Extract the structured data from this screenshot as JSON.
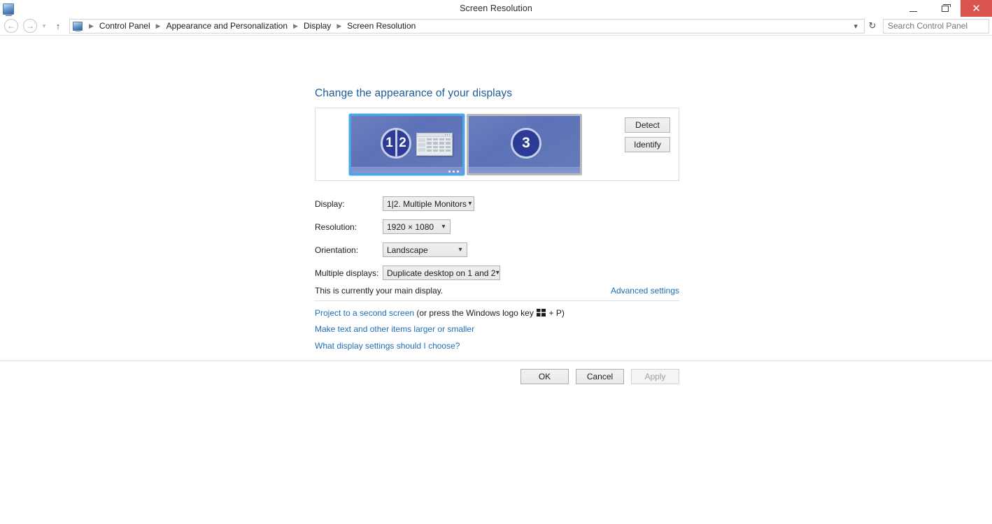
{
  "window": {
    "title": "Screen Resolution",
    "icon": "display-icon",
    "controls": {
      "minimize": "minimize-icon",
      "maximize": "restore-icon",
      "close": "close-icon"
    }
  },
  "addressbar": {
    "back": "back-arrow-icon",
    "forward": "forward-arrow-icon",
    "recent": "chevron-down-icon",
    "up": "up-arrow-icon",
    "breadcrumb": [
      "Control Panel",
      "Appearance and Personalization",
      "Display",
      "Screen Resolution"
    ],
    "history_dropdown": "chevron-down-icon",
    "refresh": "refresh-icon",
    "search": {
      "placeholder": "Search Control Panel",
      "value": "",
      "icon": "search-icon"
    }
  },
  "main": {
    "page_title": "Change the appearance of your displays",
    "preview": {
      "monitors": [
        {
          "id": "monitor-1-2",
          "label_left": "1",
          "label_right": "2",
          "selected": true,
          "dual": true
        },
        {
          "id": "monitor-3",
          "label": "3",
          "selected": false,
          "dual": false
        }
      ],
      "buttons": {
        "detect": "Detect",
        "identify": "Identify"
      }
    },
    "fields": [
      {
        "name": "display",
        "label": "Display:",
        "value": "1|2. Multiple Monitors"
      },
      {
        "name": "resolution",
        "label": "Resolution:",
        "value": "1920 × 1080"
      },
      {
        "name": "orientation",
        "label": "Orientation:",
        "value": "Landscape"
      },
      {
        "name": "multiple-displays",
        "label": "Multiple displays:",
        "value": "Duplicate desktop on 1 and 2"
      }
    ],
    "status_text": "This is currently your main display.",
    "advanced_settings_link": "Advanced settings",
    "links": {
      "project_prefix": "Project to a second screen",
      "project_mid": " (or press the Windows logo key ",
      "project_suffix": " + P)",
      "make_text": "Make text and other items larger or smaller",
      "what_display": "What display settings should I choose?"
    }
  },
  "footer": {
    "ok": "OK",
    "cancel": "Cancel",
    "apply": "Apply",
    "apply_disabled": true
  },
  "colors": {
    "accent_link": "#1f6eb5",
    "title_blue": "#1f5c99",
    "close_red": "#d9534f",
    "monitor_screen": "#657ab9",
    "monitor_badge": "#2b3b96",
    "selection_blue": "#4aa6e8"
  }
}
